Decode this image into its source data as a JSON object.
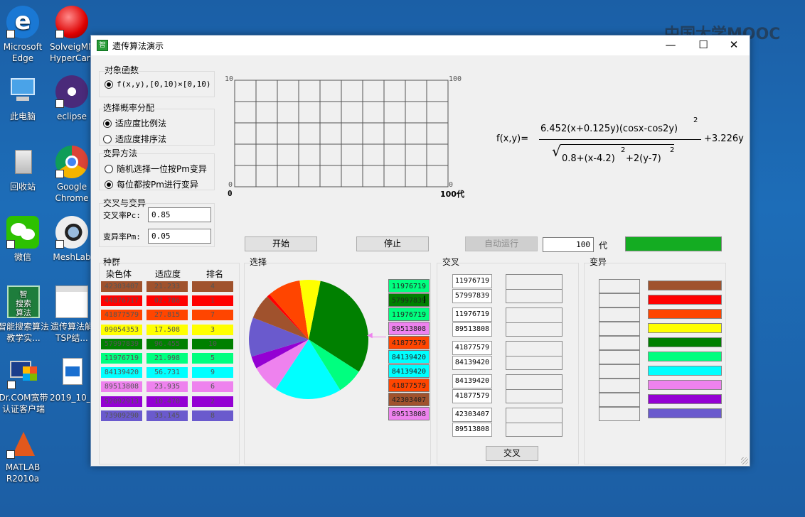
{
  "desktop": {
    "icons": [
      {
        "label": "Microsoft Edge"
      },
      {
        "label": "SolveigMM HyperCam"
      },
      {
        "label": "此电脑"
      },
      {
        "label": "eclipse"
      },
      {
        "label": "回收站"
      },
      {
        "label": "Google Chrome"
      },
      {
        "label": "微信"
      },
      {
        "label": "MeshLab"
      },
      {
        "label": "智能搜索算法教学实..."
      },
      {
        "label": "遗传算法解TSP结..."
      },
      {
        "label": "Dr.COM宽带认证客户端"
      },
      {
        "label": "2019_10_..."
      },
      {
        "label": "MATLAB R2010a"
      }
    ],
    "watermark": "中国大学MOOC"
  },
  "window": {
    "title": "遗传算法演示",
    "minimize": "—",
    "maximize": "☐",
    "close": "✕",
    "app_icon_text": "智"
  },
  "objective": {
    "group": "对象函数",
    "option": "f(x,y),[0,10)×[0,10)",
    "selected": true
  },
  "selection_dist": {
    "group": "选择概率分配",
    "options": [
      "适应度比例法",
      "适应度排序法"
    ],
    "selected_index": 0
  },
  "mutation_method": {
    "group": "变异方法",
    "options": [
      "随机选择一位按Pm变异",
      "每位都按Pm进行变异"
    ],
    "selected_index": 1
  },
  "crossover_params": {
    "group": "交叉与变异",
    "pc_label": "交叉率Pc:",
    "pc_value": "0.85",
    "pm_label": "变异率Pm:",
    "pm_value": "0.05"
  },
  "plot": {
    "y_top_left": "10",
    "y_top_right": "100",
    "y_bottom_left": "0",
    "y_bottom_right": "0",
    "x_left": "0",
    "x_right": "100代"
  },
  "formula": {
    "lhs": "f(x,y)=",
    "numerator": "6.452(x+0.125y)(cosx-cos2y)",
    "num_exp": "2",
    "den_a": "0.8+(x-4.2)",
    "den_exp1": "2",
    "den_b": "+2(y-7)",
    "den_exp2": "2",
    "tail": "+3.226y"
  },
  "controls": {
    "start": "开始",
    "stop": "停止",
    "auto_run": "自动运行",
    "generations": "100",
    "gen_unit": "代",
    "status_color": "#14ac22"
  },
  "population": {
    "group": "种群",
    "headers": [
      "染色体",
      "适应度",
      "排名"
    ],
    "rows": [
      {
        "chrom": "42303407",
        "fit": "21.233",
        "rank": "4",
        "color": "#a0522d"
      },
      {
        "chrom": "44876717",
        "fit": "02.786",
        "rank": "1",
        "color": "#ff0000"
      },
      {
        "chrom": "41877579",
        "fit": "27.815",
        "rank": "7",
        "color": "#ff4500"
      },
      {
        "chrom": "09054353",
        "fit": "17.508",
        "rank": "3",
        "color": "#ffff00"
      },
      {
        "chrom": "57997839",
        "fit": "96.455",
        "rank": "10",
        "color": "#008000"
      },
      {
        "chrom": "11976719",
        "fit": "21.998",
        "rank": "5",
        "color": "#00ff7f"
      },
      {
        "chrom": "84139420",
        "fit": "56.731",
        "rank": "9",
        "color": "#00ffff"
      },
      {
        "chrom": "89513808",
        "fit": "23.935",
        "rank": "6",
        "color": "#ee82ee"
      },
      {
        "chrom": "52092913",
        "fit": "10.470",
        "rank": "2",
        "color": "#9400d3"
      },
      {
        "chrom": "73909290",
        "fit": "33.145",
        "rank": "8",
        "color": "#6a5acd"
      }
    ]
  },
  "selection": {
    "group": "选择",
    "pie": [
      {
        "value": 96.455,
        "color": "#008000"
      },
      {
        "value": 21.998,
        "color": "#00ff7f"
      },
      {
        "value": 56.731,
        "color": "#00ffff"
      },
      {
        "value": 23.935,
        "color": "#ee82ee"
      },
      {
        "value": 10.47,
        "color": "#9400d3"
      },
      {
        "value": 33.145,
        "color": "#6a5acd"
      },
      {
        "value": 21.233,
        "color": "#a0522d"
      },
      {
        "value": 2.786,
        "color": "#ff0000"
      },
      {
        "value": 27.815,
        "color": "#ff4500"
      },
      {
        "value": 17.508,
        "color": "#ffff00"
      }
    ],
    "selected": [
      {
        "text": "11976719",
        "color": "#00ff7f"
      },
      {
        "text": "57997839",
        "color": "#008000"
      },
      {
        "text": "11976719",
        "color": "#00ff7f"
      },
      {
        "text": "89513808",
        "color": "#ee82ee"
      },
      {
        "text": "41877579",
        "color": "#ff4500"
      },
      {
        "text": "84139420",
        "color": "#00ffff"
      },
      {
        "text": "84139420",
        "color": "#00ffff"
      },
      {
        "text": "41877579",
        "color": "#ff4500"
      },
      {
        "text": "42303407",
        "color": "#a0522d"
      },
      {
        "text": "89513808",
        "color": "#ee82ee"
      }
    ]
  },
  "crossover": {
    "group": "交叉",
    "pairs": [
      [
        "11976719",
        "57997839"
      ],
      [
        "11976719",
        "89513808"
      ],
      [
        "41877579",
        "84139420"
      ],
      [
        "84139420",
        "41877579"
      ],
      [
        "42303407",
        "89513808"
      ]
    ],
    "button": "交叉"
  },
  "mutation": {
    "group": "变异",
    "colors": [
      "#a0522d",
      "#ff0000",
      "#ff4500",
      "#ffff00",
      "#008000",
      "#00ff7f",
      "#00ffff",
      "#ee82ee",
      "#9400d3",
      "#6a5acd"
    ]
  }
}
